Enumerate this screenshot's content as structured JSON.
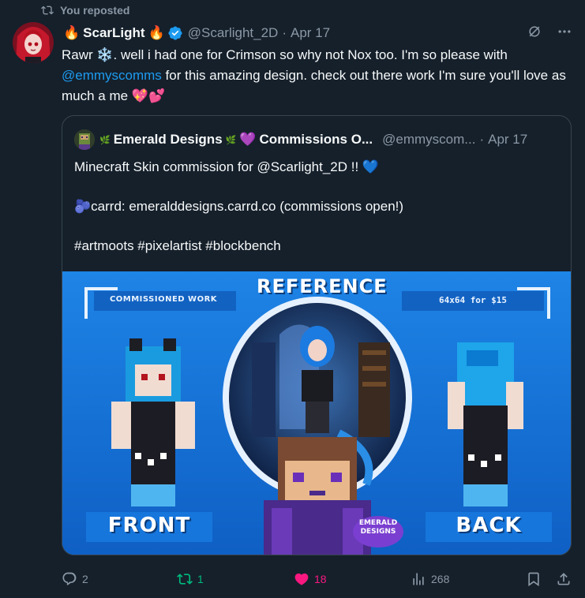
{
  "repost": {
    "label": "You reposted"
  },
  "tweet": {
    "author_name": "ScarLight",
    "handle": "@Scarlight_2D",
    "date": "Apr 17",
    "text_part1": "Rawr ❄️. well i had one for Crimson so why not Nox too. I'm so please with ",
    "mention": "@emmyscomms",
    "text_part2": " for this amazing design. check out there work I'm sure you'll love as much a me 💖💕"
  },
  "quote": {
    "author_name": "Emerald Designs",
    "author_suffix": "Commissions O...",
    "handle": "@emmyscom...",
    "date": "Apr 17",
    "line1": "Minecraft Skin commission for @Scarlight_2D !! 💙",
    "line2": "carrd: emeralddesigns.carrd.co (commissions open!)",
    "line3": "#artmoots #pixelartist #blockbench"
  },
  "media": {
    "title": "REFERENCE",
    "left_caption": "COMMISSIONED WORK",
    "right_caption": "64x64 for $15",
    "front_label": "FRONT",
    "back_label": "BACK",
    "logo_line1": "EMERALD",
    "logo_line2": "DESIGNS"
  },
  "actions": {
    "replies": "2",
    "reposts": "1",
    "likes": "18",
    "views": "268"
  },
  "colors": {
    "background": "#15202b",
    "accent": "#1d9bf0",
    "repost_green": "#00ba7c",
    "like_pink": "#f91880",
    "muted": "#8b98a5"
  },
  "icons": [
    "repost-icon",
    "verified-icon",
    "grok-icon",
    "more-icon",
    "reply-icon",
    "like-icon",
    "views-icon",
    "bookmark-icon",
    "share-icon"
  ]
}
